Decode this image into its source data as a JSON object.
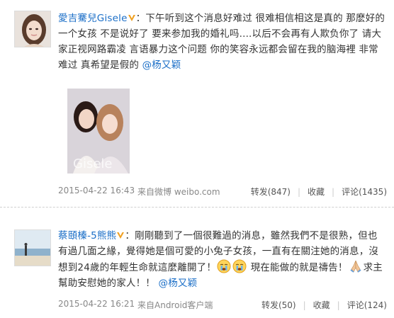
{
  "posts": [
    {
      "username": "愛吉騫兒Gisele",
      "colon": "：",
      "text": "下午听到这个消息好难过 很难相信相这是真的 那麽好的一个女孩 不是说好了 要来参加我的婚礼吗....以后不会再有人欺负你了 请大家正视网路霸凌 言语暴力这个问题 你的笑容永远都会留在我的脑海裡 非常难过 真希望是假的",
      "mention": "@杨又颖",
      "photo_watermark": "Gisele",
      "time": "2015-04-22 16:43",
      "source": "来自微博 weibo.com",
      "repost": "转发(847)",
      "favorite": "收藏",
      "comment": "评论(1435)"
    },
    {
      "username": "蔡頤榛-5熊熊",
      "colon": "：",
      "text_part1": "剛剛聽到了一個很難過的消息，雖然我們不是很熟，但也有過几面之緣，覺得她是個可愛的小兔子女孩，一直有在關注她的消息，沒想到24歲的年輕生命就這麼離開了！",
      "text_part2": "現在能做的就是禱告！",
      "text_part3": "求主幫助安慰她的家人！！",
      "mention": "@杨又颖",
      "time": "2015-04-22 16:21",
      "source": "来自Android客户端",
      "repost": "转发(50)",
      "favorite": "收藏",
      "comment": "评论(124)"
    }
  ],
  "colors": {
    "link": "#1a6ec7",
    "verified": "#f0a020",
    "meta": "#888888"
  },
  "icons": [
    "verified-v-icon",
    "crying-face-emoji",
    "praying-hands-emoji"
  ]
}
